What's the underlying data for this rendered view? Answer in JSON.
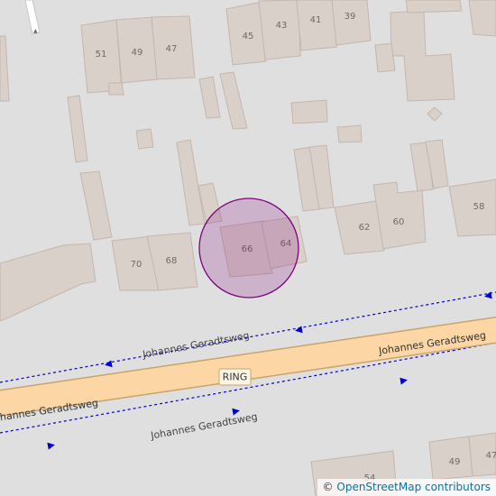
{
  "map": {
    "background": "#e0dfdf",
    "building_fill": "#d9d0c9",
    "road_fill": "#fcd6a4",
    "road_casing": "#c8a46a",
    "cycleway_color": "#0000cd",
    "highlight_color": "#800080"
  },
  "house_numbers": {
    "n51": "51",
    "n49": "49",
    "n47": "47",
    "n45": "45",
    "n43": "43",
    "n41": "41",
    "n39": "39",
    "n70": "70",
    "n68": "68",
    "n66": "66",
    "n64": "64",
    "n62": "62",
    "n60": "60",
    "n58": "58",
    "n49b": "49",
    "n47b": "47",
    "n54": "54"
  },
  "streets": {
    "main_road": "Johannes Geradtsweg",
    "main_road_left": "Johannes Geradtsweg",
    "cycle_path_north": "Johannes Geradtsweg",
    "cycle_path_south": "Johannes Geradtsweg",
    "ring_badge": "RING"
  },
  "attribution": {
    "symbol": "©",
    "text": "OpenStreetMap contributors"
  },
  "marker_icon": "highlight-circle-marker"
}
